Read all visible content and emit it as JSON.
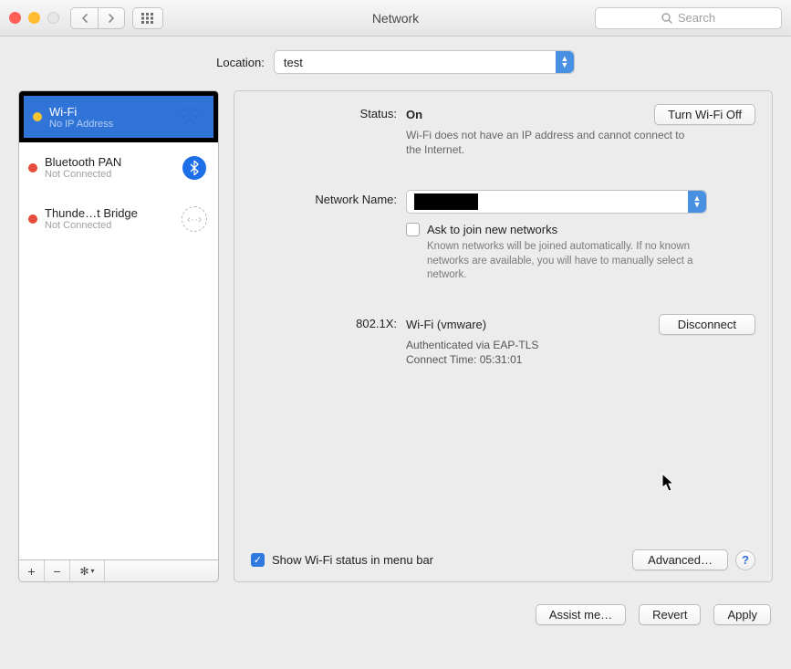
{
  "window": {
    "title": "Network",
    "search_placeholder": "Search"
  },
  "location": {
    "label": "Location:",
    "value": "test"
  },
  "sidebar": {
    "items": [
      {
        "title": "Wi-Fi",
        "subtitle": "No IP Address",
        "status": "yellow",
        "icon": "wifi"
      },
      {
        "title": "Bluetooth PAN",
        "subtitle": "Not Connected",
        "status": "red",
        "icon": "bluetooth"
      },
      {
        "title": "Thunde…t Bridge",
        "subtitle": "Not Connected",
        "status": "red",
        "icon": "thunderbolt"
      }
    ]
  },
  "main": {
    "status_label": "Status:",
    "status_value": "On",
    "wifi_toggle_label": "Turn Wi-Fi Off",
    "status_help": "Wi-Fi does not have an IP address and cannot connect to the Internet.",
    "network_name_label": "Network Name:",
    "network_name_value": "",
    "ask_join_label": "Ask to join new networks",
    "ask_join_help": "Known networks will be joined automatically. If no known networks are available, you will have to manually select a network.",
    "eap_label": "802.1X:",
    "eap_profile": "Wi-Fi (vmware)",
    "disconnect_label": "Disconnect",
    "eap_auth_line": "Authenticated via EAP-TLS",
    "eap_time_line": "Connect Time: 05:31:01",
    "show_status_label": "Show Wi-Fi status in menu bar",
    "advanced_label": "Advanced…"
  },
  "footer": {
    "assist": "Assist me…",
    "revert": "Revert",
    "apply": "Apply"
  }
}
